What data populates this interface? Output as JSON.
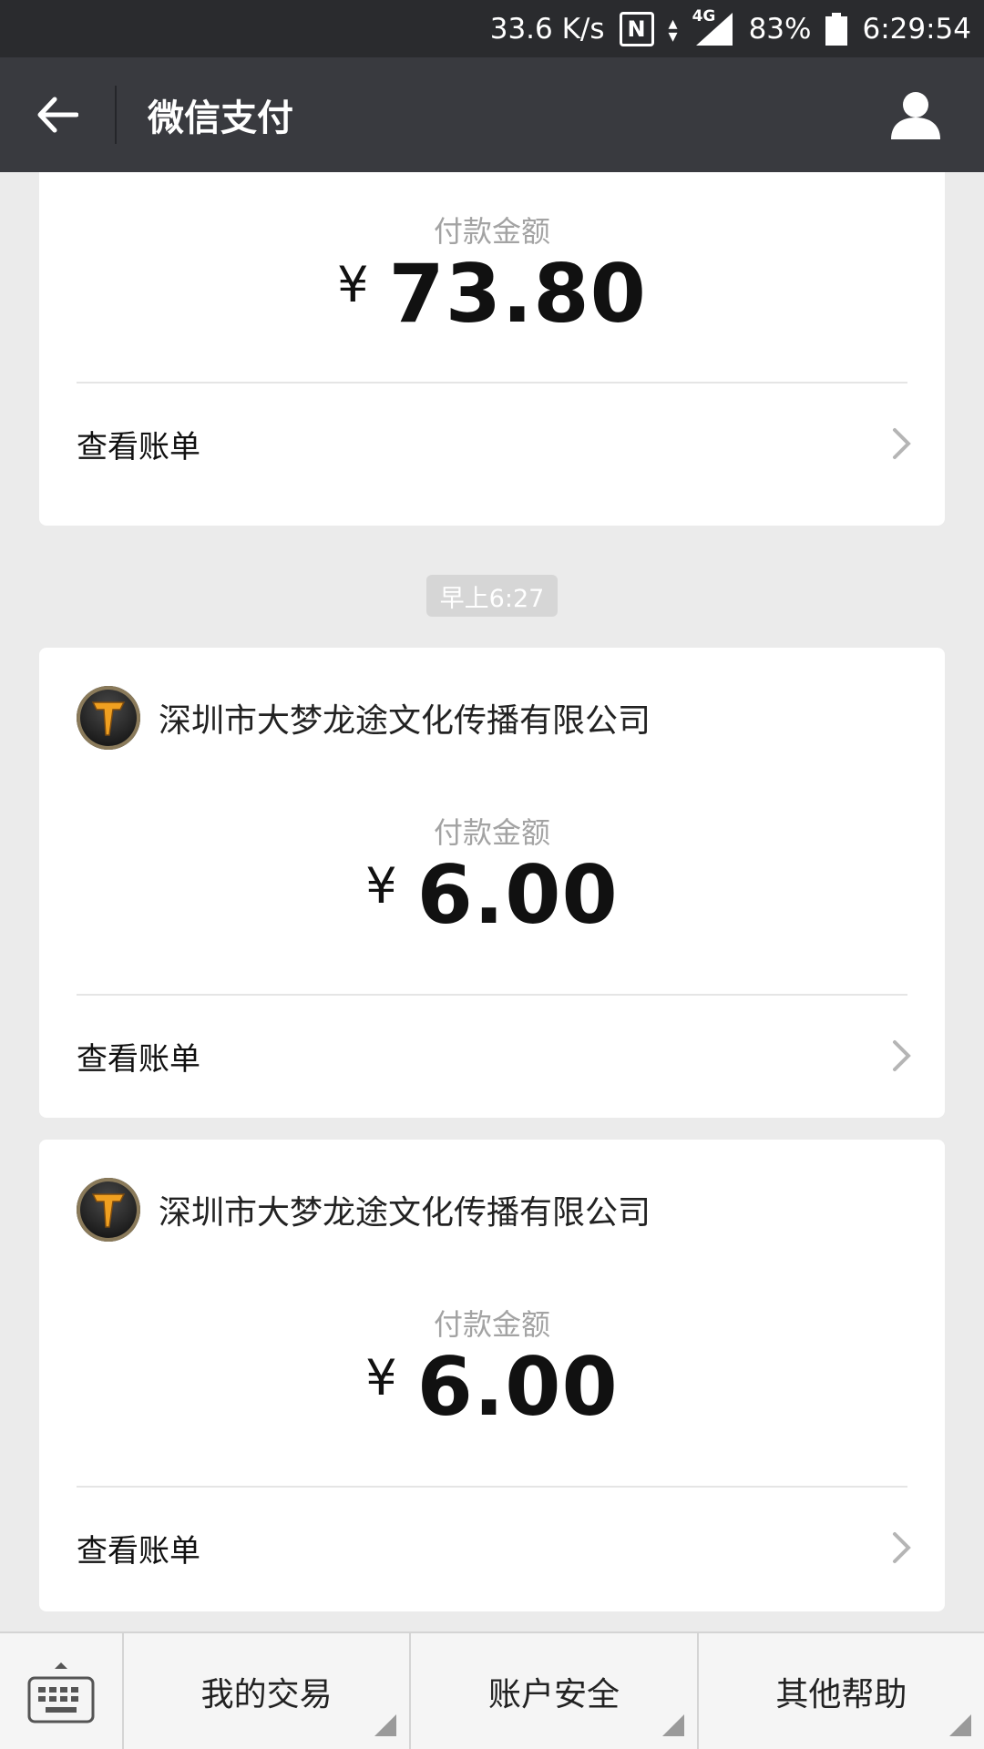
{
  "status_bar": {
    "speed": "33.6 K/s",
    "network": "4G",
    "battery": "83%",
    "time": "6:29:54",
    "nfc_glyph": "N"
  },
  "nav": {
    "title": "微信支付",
    "back_icon": "arrow-left-icon",
    "profile_icon": "user-icon"
  },
  "cards": [
    {
      "amount_label": "付款金额",
      "currency": "¥",
      "amount": "73.80",
      "view_bill": "查看账单"
    },
    {
      "merchant": "深圳市大梦龙途文化传播有限公司",
      "amount_label": "付款金额",
      "currency": "¥",
      "amount": "6.00",
      "view_bill": "查看账单"
    },
    {
      "merchant": "深圳市大梦龙途文化传播有限公司",
      "amount_label": "付款金额",
      "currency": "¥",
      "amount": "6.00",
      "view_bill": "查看账单"
    }
  ],
  "time_chip": "早上6:27",
  "bottom_tabs": [
    "我的交易",
    "账户安全",
    "其他帮助"
  ],
  "colors": {
    "nav_bg": "#393a3f",
    "status_bg": "#2a2b2e",
    "page_bg": "#ebebeb",
    "logo_orange": "#f0a020"
  }
}
